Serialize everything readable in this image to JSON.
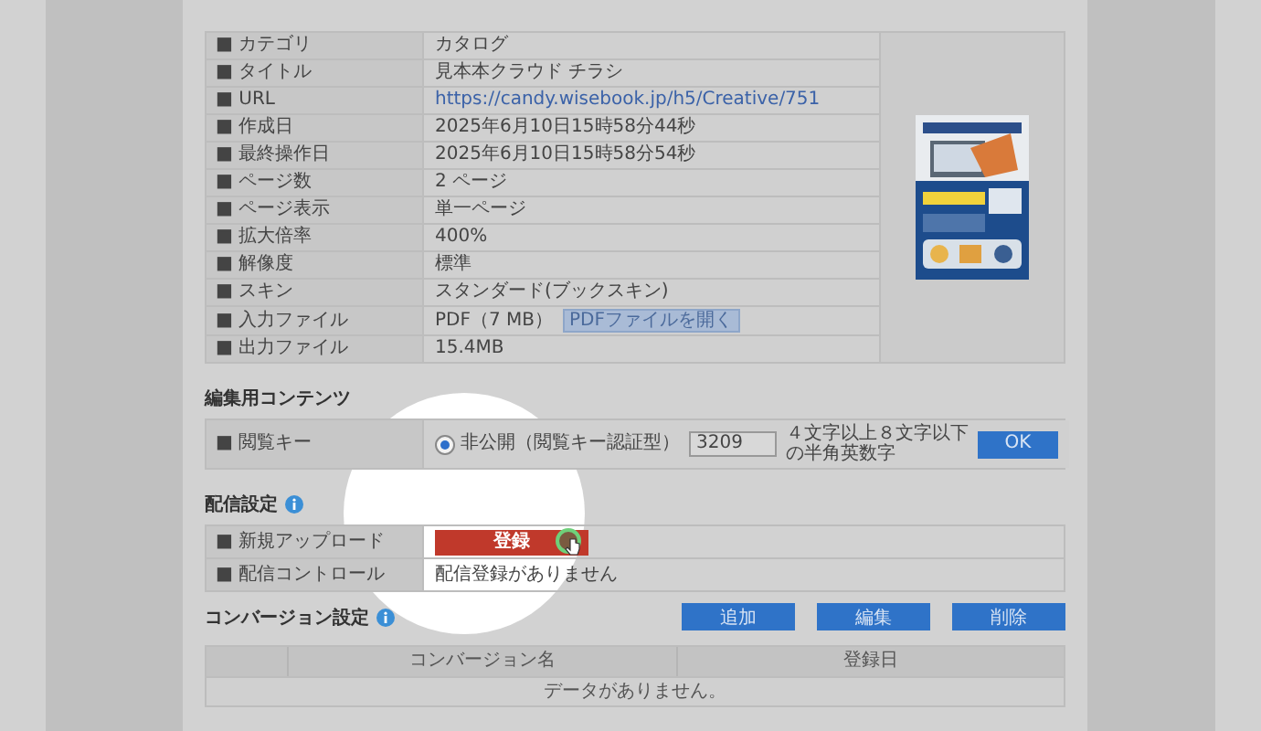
{
  "info_rows": [
    {
      "label": "■ カテゴリ",
      "value": "カタログ"
    },
    {
      "label": "■ タイトル",
      "value": "見本本クラウド チラシ"
    },
    {
      "label": "■ URL",
      "value": "https://candy.wisebook.jp/h5/Creative/751",
      "kind": "link"
    },
    {
      "label": "■ 作成日",
      "value": "2025年6月10日15時58分44秒"
    },
    {
      "label": "■ 最終操作日",
      "value": "2025年6月10日15時58分54秒"
    },
    {
      "label": "■ ページ数",
      "value": "2 ページ"
    },
    {
      "label": "■ ページ表示",
      "value": "単一ページ"
    },
    {
      "label": "■ 拡大倍率",
      "value": "400%"
    },
    {
      "label": "■ 解像度",
      "value": "標準"
    },
    {
      "label": "■ スキン",
      "value": "スタンダード(ブックスキン)"
    },
    {
      "label": "■ 入力ファイル",
      "value": "PDF（7 MB）",
      "button": "PDFファイルを開く"
    },
    {
      "label": "■ 出力ファイル",
      "value": "15.4MB"
    }
  ],
  "edit_section": {
    "heading": "編集用コンテンツ",
    "label": "■ 閲覧キー",
    "radio": {
      "label": "非公開（閲覧キー認証型）",
      "selected": true
    },
    "value": "3209",
    "hint": "４文字以上８文字以下の半角英数字",
    "button": "OK"
  },
  "delivery": {
    "heading": "配信設定",
    "rows": [
      {
        "label": "■ 新規アップロード",
        "kind": "button",
        "value": "登録"
      },
      {
        "label": "■ 配信コントロール",
        "kind": "text",
        "value": "配信登録がありません"
      }
    ]
  },
  "conversion": {
    "heading": "コンバージョン設定",
    "buttons": [
      "追加",
      "編集",
      "削除"
    ],
    "columns": [
      "コンバージョン名",
      "登録日"
    ],
    "empty_message": "データがありません。"
  }
}
